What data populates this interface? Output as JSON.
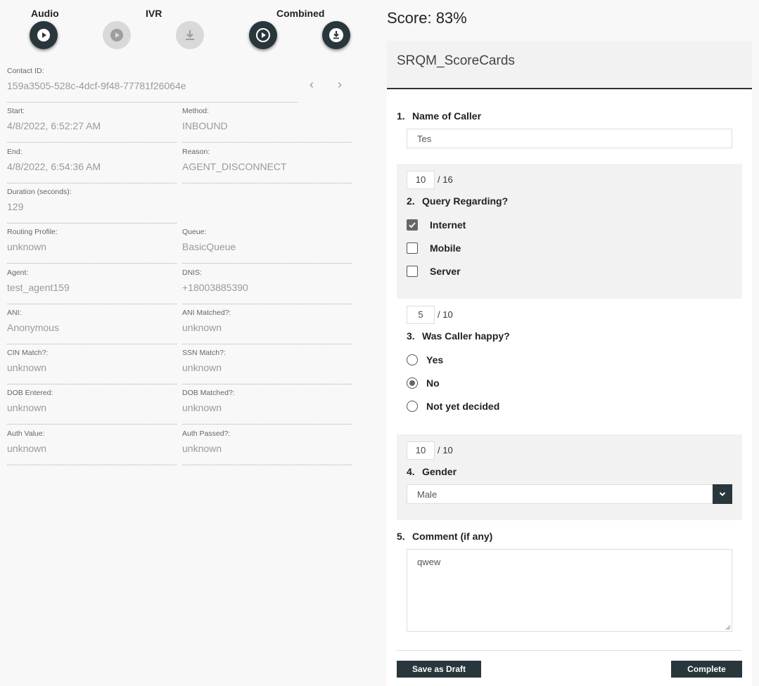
{
  "media": {
    "audio_label": "Audio",
    "ivr_label": "IVR",
    "combined_label": "Combined"
  },
  "contact": {
    "contact_id_label": "Contact ID:",
    "contact_id": "159a3505-528c-4dcf-9f48-77781f26064e",
    "start_label": "Start:",
    "start": "4/8/2022, 6:52:27 AM",
    "method_label": "Method:",
    "method": "INBOUND",
    "end_label": "End:",
    "end": "4/8/2022, 6:54:36 AM",
    "reason_label": "Reason:",
    "reason": "AGENT_DISCONNECT",
    "duration_label": "Duration (seconds):",
    "duration": "129",
    "routing_label": "Routing Profile:",
    "routing": "unknown",
    "queue_label": "Queue:",
    "queue": "BasicQueue",
    "agent_label": "Agent:",
    "agent": "test_agent159",
    "dnis_label": "DNIS:",
    "dnis": "+18003885390",
    "ani_label": "ANI:",
    "ani": "Anonymous",
    "ani_matched_label": "ANI Matched?:",
    "ani_matched": "unknown",
    "cin_label": "CIN Match?:",
    "cin": "unknown",
    "ssn_label": "SSN Match?:",
    "ssn": "unknown",
    "dob_entered_label": "DOB Entered:",
    "dob_entered": "unknown",
    "dob_matched_label": "DOB Matched?:",
    "dob_matched": "unknown",
    "auth_value_label": "Auth Value:",
    "auth_value": "unknown",
    "auth_passed_label": "Auth Passed?:",
    "auth_passed": "unknown"
  },
  "scorecard": {
    "score_text": "Score: 83%",
    "title": "SRQM_ScoreCards",
    "q1": {
      "num": "1.",
      "title": "Name of Caller",
      "value": "Tes"
    },
    "q2": {
      "score": "10",
      "max": "/ 16",
      "num": "2.",
      "title": "Query Regarding?",
      "options": [
        {
          "label": "Internet",
          "checked": true
        },
        {
          "label": "Mobile",
          "checked": false
        },
        {
          "label": "Server",
          "checked": false
        }
      ]
    },
    "q3": {
      "score": "5",
      "max": "/ 10",
      "num": "3.",
      "title": "Was Caller happy?",
      "options": [
        {
          "label": "Yes",
          "checked": false
        },
        {
          "label": "No",
          "checked": true
        },
        {
          "label": "Not yet decided",
          "checked": false
        }
      ]
    },
    "q4": {
      "score": "10",
      "max": "/ 10",
      "num": "4.",
      "title": "Gender",
      "value": "Male"
    },
    "q5": {
      "num": "5.",
      "title": "Comment (if any)",
      "value": "qwew"
    },
    "save_draft_label": "Save as Draft",
    "complete_label": "Complete"
  }
}
